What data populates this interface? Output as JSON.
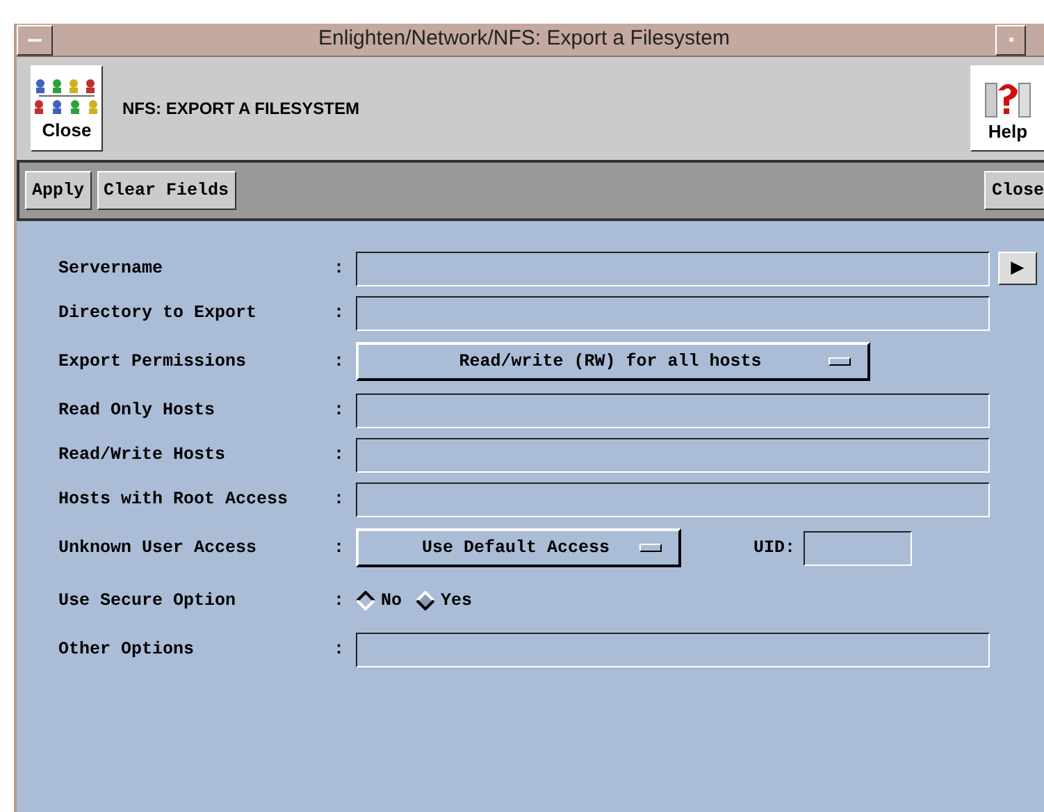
{
  "window": {
    "title": "Enlighten/Network/NFS: Export a Filesystem"
  },
  "header": {
    "close_label": "Close",
    "title": "NFS: EXPORT A FILESYSTEM",
    "help_label": "Help"
  },
  "toolbar": {
    "left": [
      "Apply",
      "Clear Fields"
    ],
    "right": "Close"
  },
  "rows": [
    {
      "kind": "text",
      "label": "Servername",
      "colon": ":",
      "arrow": "▶"
    },
    {
      "kind": "text",
      "label": "Directory to Export",
      "colon": ":"
    },
    {
      "kind": "dropdown",
      "label": "Export Permissions",
      "colon": ":",
      "value": "Read/write (RW) for all hosts"
    },
    {
      "kind": "text",
      "label": "Read Only Hosts",
      "colon": ":"
    },
    {
      "kind": "text",
      "label": "Read/Write Hosts",
      "colon": ":"
    },
    {
      "kind": "text",
      "label": "Hosts with Root Access",
      "colon": ":"
    },
    {
      "kind": "dropdown",
      "label": "Unknown User Access",
      "colon": ":",
      "value": "Use Default Access",
      "extra_label": "UID:"
    },
    {
      "kind": "radio",
      "label": "Use Secure Option",
      "colon": ":",
      "options": [
        {
          "label": "No",
          "selected": true
        },
        {
          "label": "Yes",
          "selected": false
        }
      ]
    },
    {
      "kind": "text",
      "label": "Other Options",
      "colon": ":"
    }
  ]
}
